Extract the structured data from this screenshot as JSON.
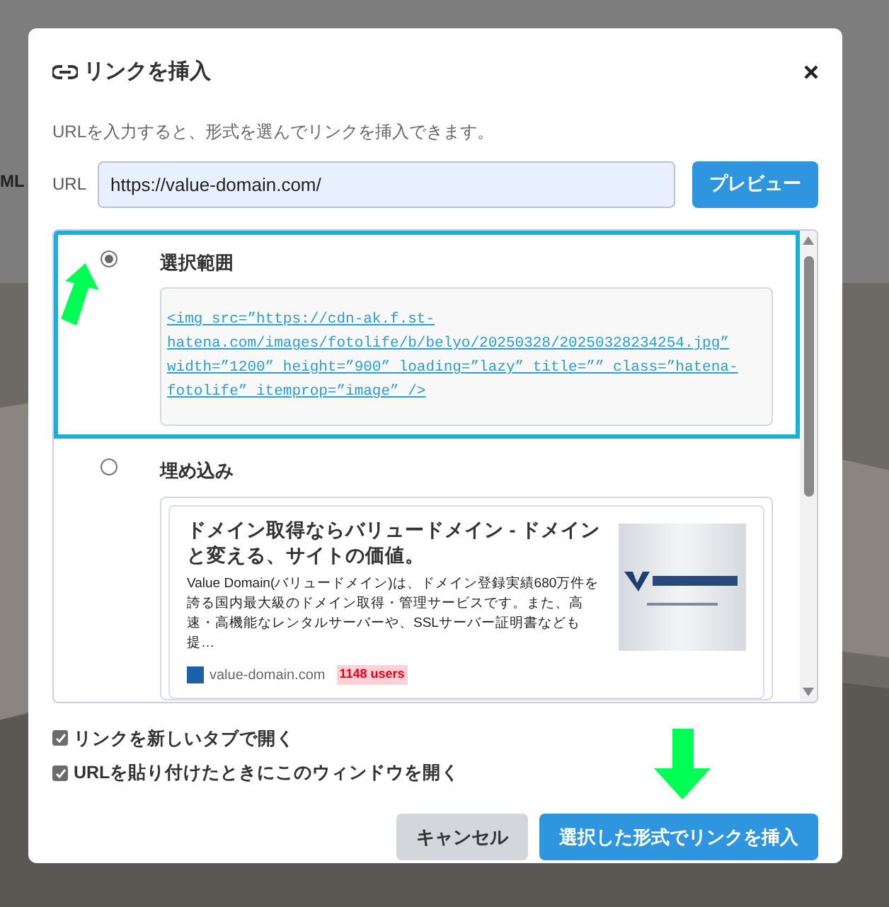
{
  "background": {
    "text": "ML"
  },
  "dialog": {
    "title": "リンクを挿入",
    "description": "URLを入力すると、形式を選んでリンクを挿入できます。",
    "url_label": "URL",
    "url_value": "https://value-domain.com/",
    "preview_button": "プレビュー",
    "options": [
      {
        "kind": "code",
        "label": "選択範囲",
        "selected": true,
        "code": "<img src=”https://cdn-ak.f.st-hatena.com/images/fotolife/b/belyo/20250328/20250328234254.jpg” width=”1200” height=”900” loading=”lazy” title=”” class=”hatena-fotolife” itemprop=”image” />"
      },
      {
        "kind": "embed",
        "label": "埋め込み",
        "selected": false,
        "embed": {
          "title": "ドメイン取得ならバリュードメイン - ドメインと変える、サイトの価値。",
          "description": "Value Domain(バリュードメイン)は、ドメイン登録実績680万件を誇る国内最大級のドメイン取得・管理サービスです。また、高速・高機能なレンタルサーバーや、SSLサーバー証明書なども提…",
          "site": "value-domain.com",
          "users": "1148 users"
        }
      }
    ],
    "checkboxes": [
      {
        "label": "リンクを新しいタブで開く",
        "checked": true
      },
      {
        "label": "URLを貼り付けたときにこのウィンドウを開く",
        "checked": true
      }
    ],
    "buttons": [
      {
        "kind": "secondary",
        "label": "キャンセル"
      },
      {
        "kind": "primary",
        "label": "選択した形式でリンクを挿入"
      }
    ]
  }
}
